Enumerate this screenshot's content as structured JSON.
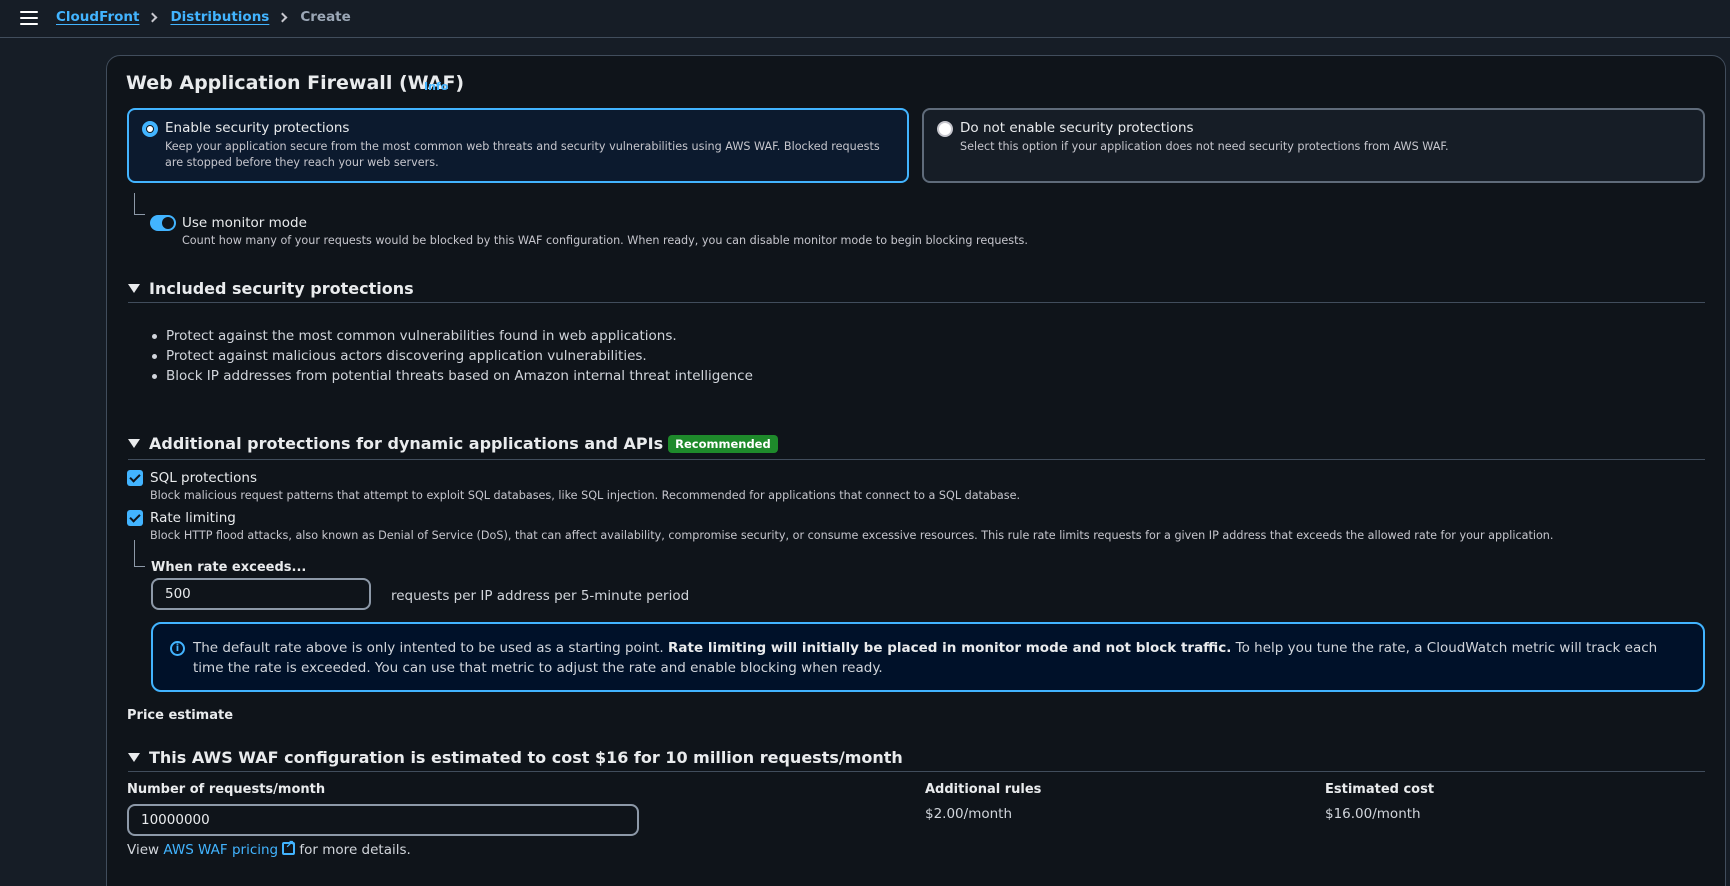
{
  "breadcrumb": {
    "items": [
      "CloudFront",
      "Distributions"
    ],
    "current": "Create"
  },
  "waf": {
    "title": "Web Application Firewall (WAF)",
    "info": "Info",
    "options": [
      {
        "label": "Enable security protections",
        "desc": "Keep your application secure from the most common web threats and security vulnerabilities using AWS WAF. Blocked requests are stopped before they reach your web servers."
      },
      {
        "label": "Do not enable security protections",
        "desc": "Select this option if your application does not need security protections from AWS WAF."
      }
    ],
    "monitor": {
      "label": "Use monitor mode",
      "desc": "Count how many of your requests would be blocked by this WAF configuration. When ready, you can disable monitor mode to begin blocking requests."
    }
  },
  "included": {
    "heading": "Included security protections",
    "bullets": [
      "Protect against the most common vulnerabilities found in web applications.",
      "Protect against malicious actors discovering application vulnerabilities.",
      "Block IP addresses from potential threats based on Amazon internal threat intelligence"
    ]
  },
  "additional": {
    "heading": "Additional protections for dynamic applications and APIs",
    "badge": "Recommended",
    "sql": {
      "label": "SQL protections",
      "desc": "Block malicious request patterns that attempt to exploit SQL databases, like SQL injection. Recommended for applications that connect to a SQL database."
    },
    "rate": {
      "label": "Rate limiting",
      "desc": "Block HTTP flood attacks, also known as Denial of Service (DoS), that can affect availability, compromise security, or consume excessive resources. This rule rate limits requests for a given IP address that exceeds the allowed rate for your application."
    },
    "rate_exceeds_label": "When rate exceeds...",
    "rate_value": "500",
    "rate_unit": "requests per IP address per 5-minute period",
    "alert": {
      "prefix": "The default rate above is only intented to be used as a starting point.",
      "bold": "Rate limiting will initially be placed in monitor mode and not block traffic.",
      "suffix": "To help you tune the rate, a CloudWatch metric will track each time the rate is exceeded. You can use that metric to adjust the rate and enable blocking when ready."
    }
  },
  "price": {
    "label": "Price estimate",
    "heading": "This AWS WAF configuration is estimated to cost $16 for 10 million requests/month",
    "requests_label": "Number of requests/month",
    "requests_value": "10000000",
    "rules_label": "Additional rules",
    "rules_value": "$2.00/month",
    "cost_label": "Estimated cost",
    "cost_value": "$16.00/month",
    "view_prefix": "View",
    "view_link": "AWS WAF pricing",
    "view_suffix": "for more details."
  }
}
